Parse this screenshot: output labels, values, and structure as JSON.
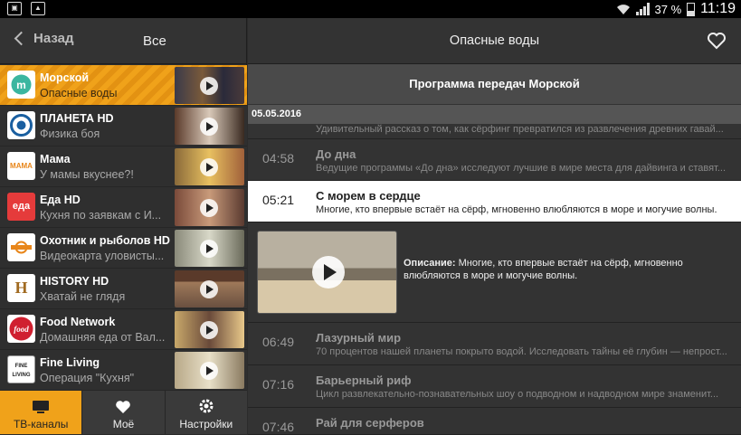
{
  "statusbar": {
    "battery": "37 %",
    "time": "11:19"
  },
  "left_header": {
    "back_label": "Назад",
    "filter_label": "Все"
  },
  "channels": [
    {
      "name": "Морской",
      "show": "Опасные воды",
      "logo_text": "m",
      "active": true
    },
    {
      "name": "ПЛАНЕТА HD",
      "show": "Физика боя",
      "logo_text": ""
    },
    {
      "name": "Мама",
      "show": "У мамы вкуснее?!",
      "logo_text": "МАМА"
    },
    {
      "name": "Еда HD",
      "show": "Кухня по заявкам с И...",
      "logo_text": "еда"
    },
    {
      "name": "Охотник и рыболов HD",
      "show": "Видеокарта уловисты...",
      "logo_text": ""
    },
    {
      "name": "HISTORY HD",
      "show": "Хватай не глядя",
      "logo_text": "H"
    },
    {
      "name": "Food Network",
      "show": "Домашняя еда от Вал...",
      "logo_text": "food"
    },
    {
      "name": "Fine Living",
      "show": "Операция \"Кухня\"",
      "logo_text": "FINE LIVING"
    }
  ],
  "bottom_nav": {
    "tv": "ТВ-каналы",
    "mine": "Моё",
    "settings": "Настройки"
  },
  "right_header": {
    "title": "Опасные воды"
  },
  "program_header": "Программа передач Морской",
  "date": "05.05.2016",
  "programs": [
    {
      "time": "",
      "title": "",
      "desc": "Удивительный рассказ о том, как сёрфинг превратился из развлечения древних гавай..."
    },
    {
      "time": "04:58",
      "title": "До дна",
      "desc": "Ведущие программы «До дна» исследуют лучшие в мире места для дайвинга и ставят..."
    },
    {
      "time": "05:21",
      "title": "С морем в сердце",
      "desc": "Многие, кто впервые встаёт на сёрф, мгновенно влюбляются в море и могучие волны."
    },
    {
      "time": "06:49",
      "title": "Лазурный мир",
      "desc": "70 процентов нашей планеты покрыто водой. Исследовать тайны её глубин — непрост..."
    },
    {
      "time": "07:16",
      "title": "Барьерный риф",
      "desc": "Цикл развлекательно-познавательных шоу о подводном и надводном мире знаменит..."
    },
    {
      "time": "07:46",
      "title": "Рай для серферов",
      "desc": ""
    }
  ],
  "detail": {
    "label": "Описание:",
    "text": "Многие, кто впервые встаёт на сёрф, мгновенно влюбляются в море и могучие волны."
  }
}
